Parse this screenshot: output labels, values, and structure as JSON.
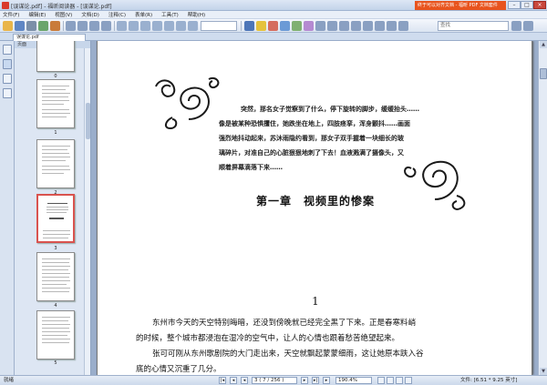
{
  "window": {
    "title": "[误谋论.pdf] - 福昕阅读器 - [误谋论.pdf]",
    "promo": "终于可以对齐文档 - 福昕 PDF 文档套件",
    "min_label": "–",
    "max_label": "□",
    "close_label": "×"
  },
  "menu": [
    "文件(F)",
    "编辑(E)",
    "视图(V)",
    "文档(D)",
    "注释(C)",
    "表单(R)",
    "工具(T)",
    "帮助(H)"
  ],
  "toolbar": {
    "zoom_value": "",
    "search_placeholder": "查找"
  },
  "tab": {
    "label": "误谋论.pdf"
  },
  "thumbnails": {
    "header": "页面",
    "labels": [
      "0",
      "1",
      "2",
      "3",
      "4",
      "5"
    ]
  },
  "document": {
    "intro_lines": [
      "突然，那名女子觉察到了什么，停下旋转的脚步，缓缓抬头……",
      "像是被某种恐惧攫住，她跌坐在地上，四肢痉挛，浑身颤抖……画面",
      "强烈地抖动起来，苏沐雨隐约看到，那女子双手握着一块细长的玻",
      "璃碎片，对准自己的心脏狠狠地刺了下去！血液溅满了摄像头，又",
      "顺着屏幕滴落下来……"
    ],
    "chapter_title": "第一章　视频里的惨案",
    "page_number": "1",
    "body_lines": [
      "东州市今天的天空特别晦暗，还没到傍晚就已经完全黑了下来。正是春寒料峭",
      "的时候，整个城市都浸泡在湿冷的空气中，让人的心情也跟着愁苦绝望起来。",
      "张可可刚从东州歌剧院的大门走出来，天空就飘起蒙蒙细雨，这让她原本趺入谷",
      "底的心情又沉重了几分。"
    ]
  },
  "statusbar": {
    "status": "就绪",
    "page_field": "3 ( 7 / 256 )",
    "zoom_field": "190.4%",
    "page_size": "文件: [6.51 * 9.25 英寸]"
  }
}
